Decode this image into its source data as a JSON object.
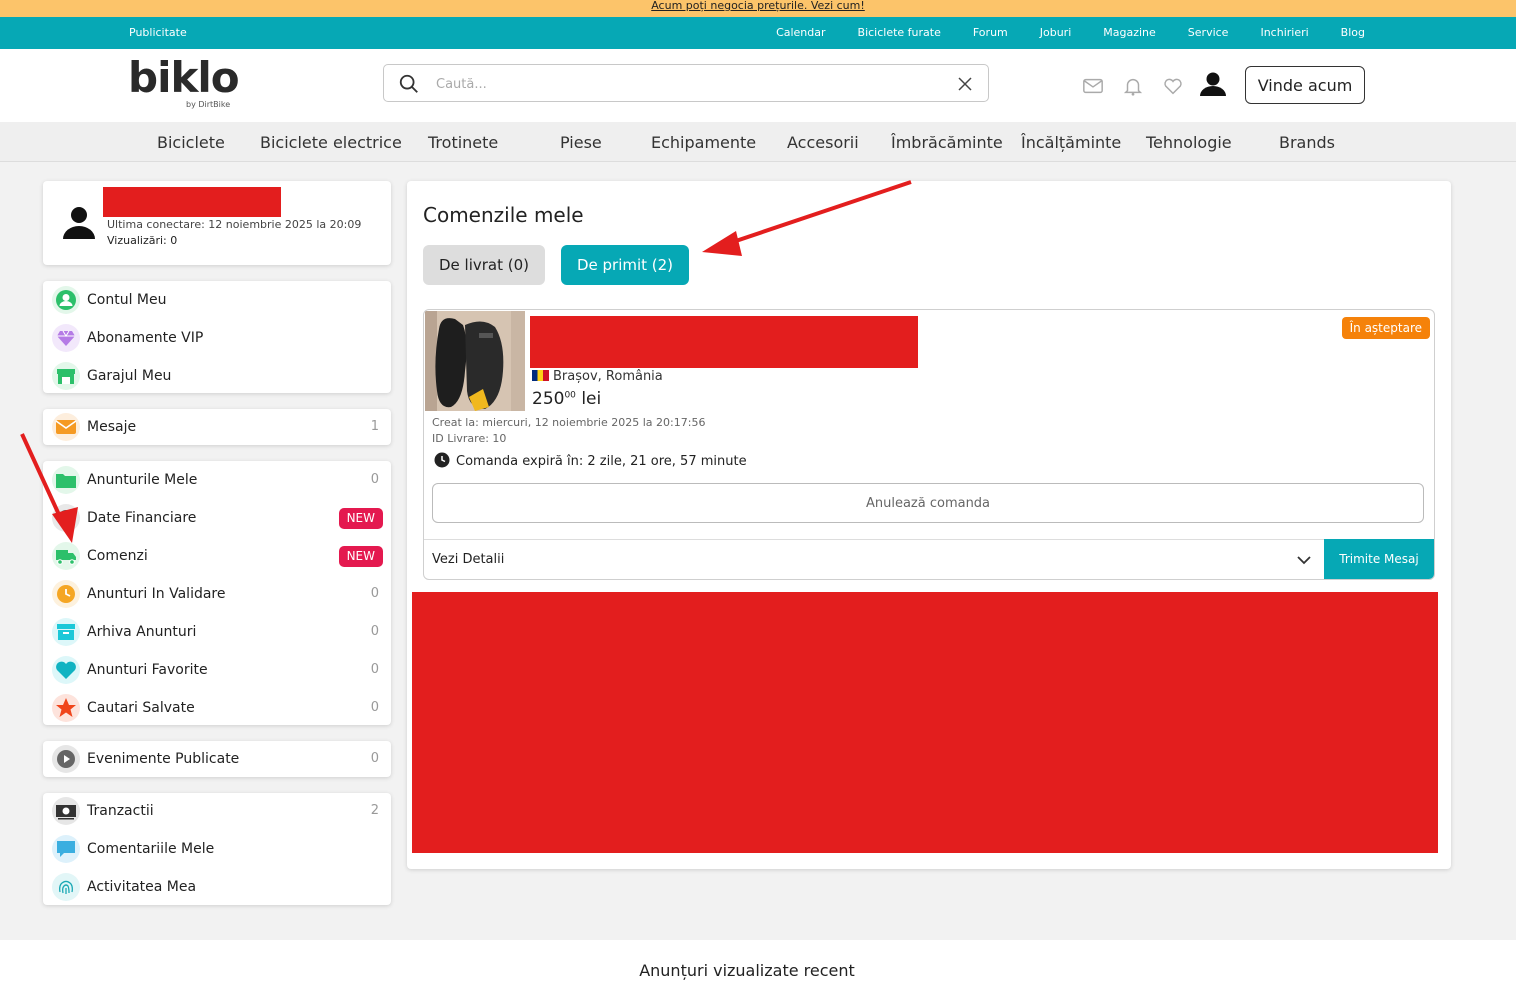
{
  "promo": {
    "text": "Acum poți negocia prețurile. Vezi cum!"
  },
  "topnav": {
    "left": "Publicitate",
    "links": [
      "Calendar",
      "Biciclete furate",
      "Forum",
      "Joburi",
      "Magazine",
      "Service",
      "Inchirieri",
      "Blog"
    ]
  },
  "header": {
    "logo": "biklo",
    "logo_sub": "by DirtBike",
    "search_placeholder": "Caută...",
    "sell_button": "Vinde acum",
    "icons": [
      "search-icon",
      "close-icon",
      "mail-icon",
      "bell-icon",
      "heart-icon",
      "user-avatar"
    ]
  },
  "categories": [
    "Biciclete",
    "Biciclete electrice",
    "Trotinete",
    "Piese",
    "Echipamente",
    "Accesorii",
    "Îmbrăcăminte",
    "Încălțăminte",
    "Tehnologie",
    "Brands"
  ],
  "profile": {
    "last_login": "Ultima conectare: 12 noiembrie 2025 la 20:09",
    "views": "Vizualizări: 0"
  },
  "sidebar": {
    "group1": [
      {
        "label": "Contul Meu",
        "icon": "user-circle-icon"
      },
      {
        "label": "Abonamente VIP",
        "icon": "diamond-icon"
      },
      {
        "label": "Garajul Meu",
        "icon": "garage-icon"
      }
    ],
    "group2": [
      {
        "label": "Mesaje",
        "icon": "mail-icon",
        "count": "1"
      }
    ],
    "group3": [
      {
        "label": "Anunturile Mele",
        "icon": "folder-icon",
        "count": "0"
      },
      {
        "label": "Date Financiare",
        "icon": "finance-icon",
        "badge": "NEW"
      },
      {
        "label": "Comenzi",
        "icon": "truck-icon",
        "badge": "NEW"
      },
      {
        "label": "Anunturi In Validare",
        "icon": "clock-icon",
        "count": "0"
      },
      {
        "label": "Arhiva Anunturi",
        "icon": "archive-icon",
        "count": "0"
      },
      {
        "label": "Anunturi Favorite",
        "icon": "heart-icon",
        "count": "0"
      },
      {
        "label": "Cautari Salvate",
        "icon": "star-icon",
        "count": "0"
      }
    ],
    "group4": [
      {
        "label": "Evenimente Publicate",
        "icon": "play-icon",
        "count": "0"
      }
    ],
    "group5": [
      {
        "label": "Tranzactii",
        "icon": "cash-icon",
        "count": "2"
      },
      {
        "label": "Comentariile Mele",
        "icon": "comment-icon"
      },
      {
        "label": "Activitatea Mea",
        "icon": "fingerprint-icon"
      }
    ]
  },
  "main": {
    "title": "Comenzile mele",
    "tabs": [
      "De livrat (0)",
      "De primit (2)"
    ]
  },
  "order": {
    "status": "În așteptare",
    "location": "Brașov, România",
    "price_int": "250",
    "price_dec": "00",
    "currency": "lei",
    "created": "Creat la: miercuri, 12 noiembrie 2025 la 20:17:56",
    "delivery_id": "ID Livrare: 10",
    "expires": "Comanda expiră în: 2 zile, 21 ore, 57 minute",
    "cancel_button": "Anulează comanda",
    "details_label": "Vezi Detalii",
    "send_button": "Trimite Mesaj"
  },
  "footer": {
    "title": "Anunțuri vizualizate recent"
  },
  "colors": {
    "teal": "#06a8b5",
    "promo": "#fcc46a",
    "badge": "#e4194f",
    "status": "#f5820a",
    "redaction": "#e31e1e"
  }
}
